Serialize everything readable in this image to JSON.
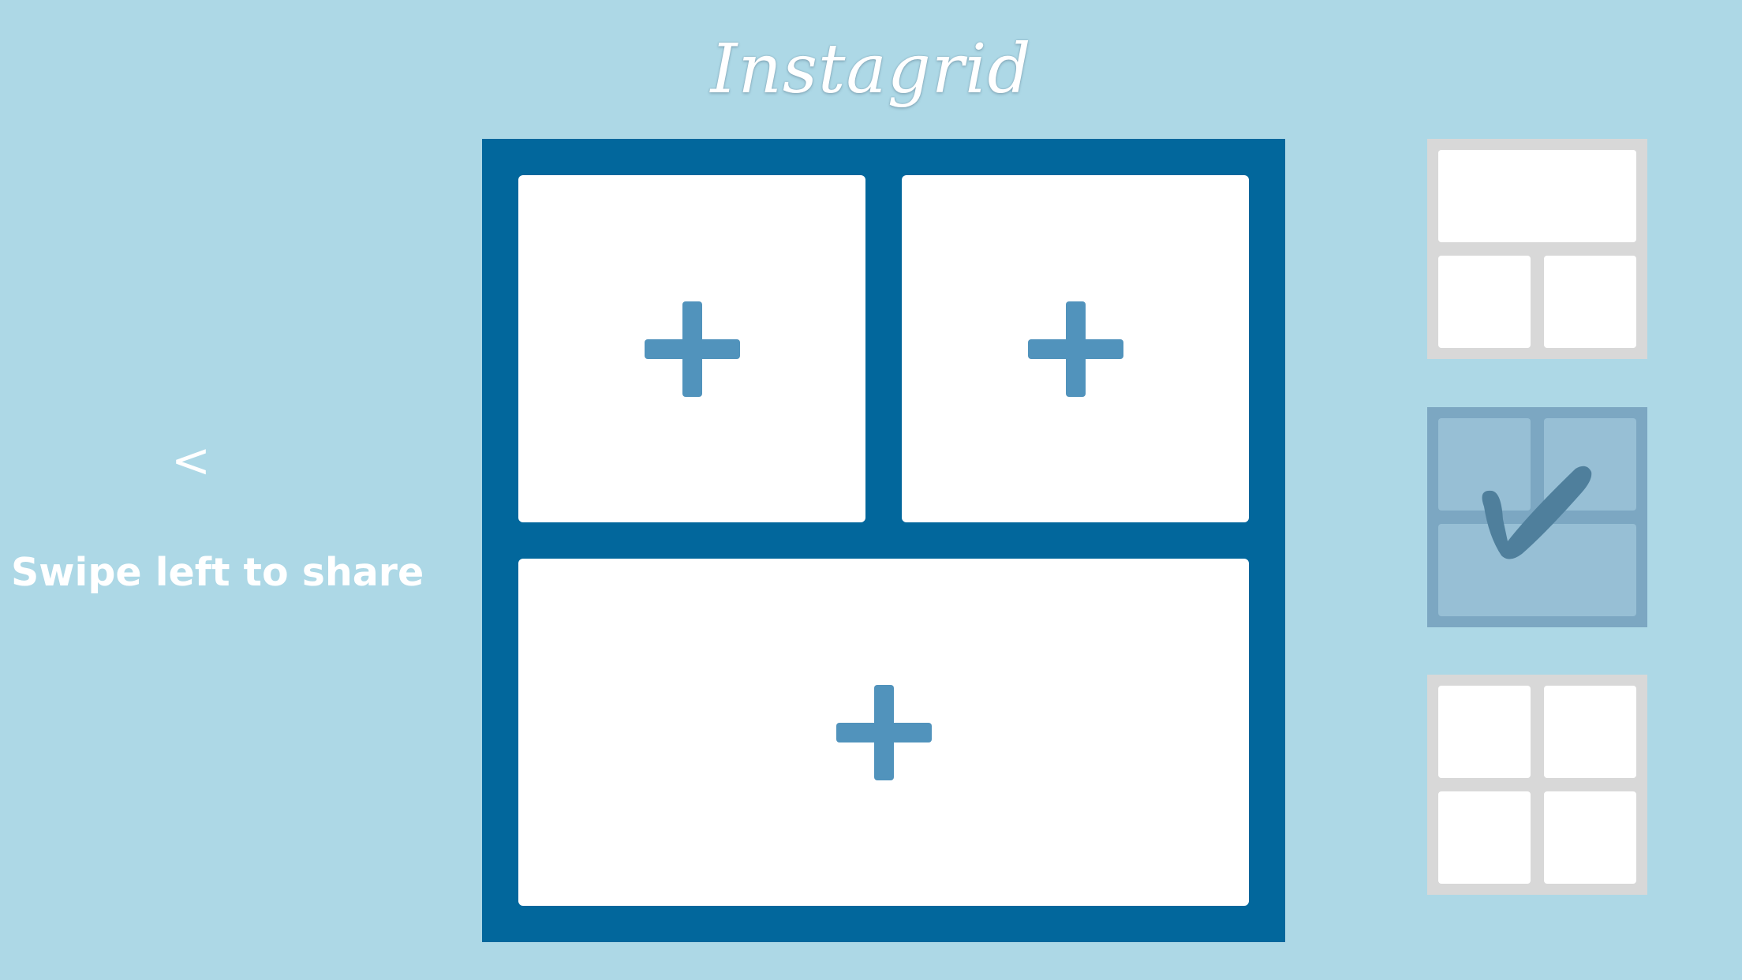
{
  "app": {
    "title": "Instagrid"
  },
  "swipe": {
    "arrow": "<",
    "label": "Swipe left to share"
  },
  "grid": {
    "selected_layout": 2,
    "slots": [
      {
        "icon": "plus-icon"
      },
      {
        "icon": "plus-icon"
      },
      {
        "icon": "plus-icon"
      }
    ]
  },
  "layouts": [
    {
      "name": "one-top-two-bottom",
      "selected": false
    },
    {
      "name": "two-top-one-bottom",
      "selected": true,
      "icon": "checkmark-icon"
    },
    {
      "name": "four-square",
      "selected": false
    }
  ],
  "colors": {
    "background": "#add8e6",
    "frame": "#02679c",
    "plus": "#5193bc",
    "selected_overlay": "#7ca7c2",
    "checkmark": "#4f7f9c",
    "layout_button": "#d8d8d8"
  }
}
